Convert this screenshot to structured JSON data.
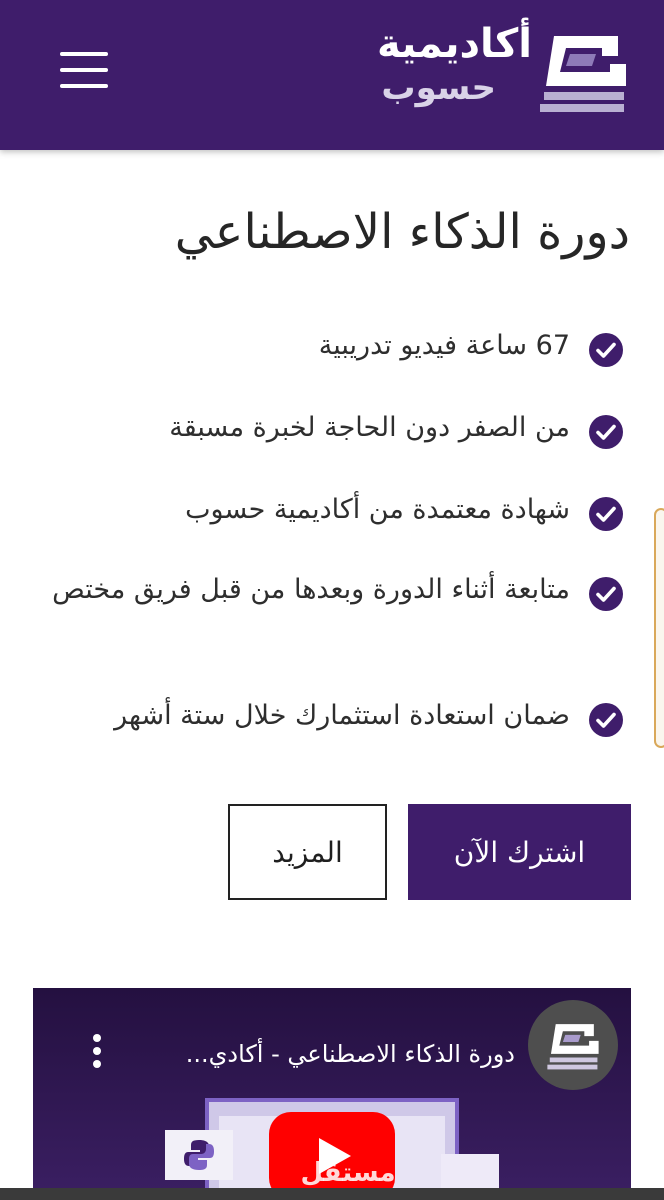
{
  "header": {
    "brand_line1": "أكاديمية",
    "brand_line2": "حسوب",
    "menu_icon": "hamburger-menu-icon",
    "logo_icon": "hsoub-logo-icon",
    "background_color": "#3f1d6b"
  },
  "course": {
    "title": "دورة الذكاء الاصطناعي",
    "features": [
      "67 ساعة فيديو تدريبية",
      "من الصفر دون الحاجة لخبرة مسبقة",
      "شهادة معتمدة من أكاديمية حسوب",
      "متابعة أثناء الدورة وبعدها من قبل فريق مختص",
      "ضمان استعادة استثمارك خلال ستة أشهر"
    ],
    "feature_icon": "check-circle-icon",
    "check_color": "#3f1d6b"
  },
  "actions": {
    "subscribe_label": "اشترك الآن",
    "more_label": "المزيد"
  },
  "video": {
    "title": "دورة الذكاء الاصطناعي - أكادي...",
    "more_icon": "kebab-menu-icon",
    "play_icon": "youtube-play-icon",
    "channel_icon": "channel-avatar-icon",
    "watermark": "مستقل"
  }
}
